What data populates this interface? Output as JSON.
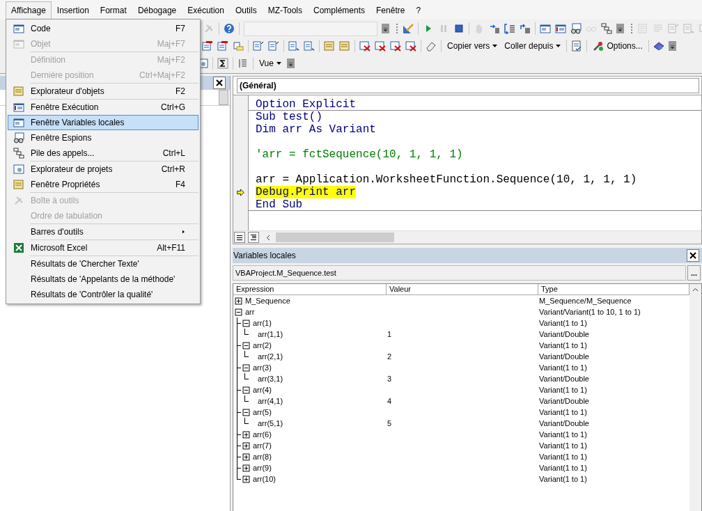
{
  "menubar": [
    {
      "label": "Affichage",
      "selected": true
    },
    {
      "label": "Insertion",
      "selected": false
    },
    {
      "label": "Format",
      "selected": false
    },
    {
      "label": "Débogage",
      "selected": false
    },
    {
      "label": "Exécution",
      "selected": false
    },
    {
      "label": "Outils",
      "selected": false
    },
    {
      "label": "MZ-Tools",
      "selected": false
    },
    {
      "label": "Compléments",
      "selected": false
    },
    {
      "label": "Fenêtre",
      "selected": false
    },
    {
      "label": "?",
      "selected": false
    }
  ],
  "toolbar_rows": [
    [
      {
        "kind": "icon",
        "disabled": true
      },
      {
        "kind": "separator"
      },
      {
        "kind": "icon",
        "disabled": false
      },
      {
        "kind": "separator"
      },
      {
        "kind": "combo",
        "disabled": true
      },
      {
        "kind": "overflow"
      },
      {
        "kind": "grip"
      },
      {
        "kind": "icon",
        "disabled": false
      },
      {
        "kind": "separator"
      },
      {
        "kind": "icon",
        "disabled": false
      },
      {
        "kind": "icon",
        "disabled": true
      },
      {
        "kind": "icon",
        "disabled": false
      },
      {
        "kind": "separator"
      },
      {
        "kind": "icon",
        "disabled": true
      },
      {
        "kind": "icon",
        "disabled": false
      },
      {
        "kind": "icon",
        "disabled": false
      },
      {
        "kind": "icon",
        "disabled": false
      },
      {
        "kind": "separator"
      },
      {
        "kind": "icon",
        "disabled": false
      },
      {
        "kind": "icon",
        "disabled": false
      },
      {
        "kind": "icon",
        "disabled": false
      },
      {
        "kind": "icon",
        "disabled": true
      },
      {
        "kind": "icon",
        "disabled": false
      },
      {
        "kind": "overflow"
      },
      {
        "kind": "grip"
      },
      {
        "kind": "icon",
        "disabled": true
      },
      {
        "kind": "icon",
        "disabled": true
      },
      {
        "kind": "icon",
        "disabled": true
      },
      {
        "kind": "icon",
        "disabled": true
      },
      {
        "kind": "icon",
        "disabled": true
      }
    ],
    [
      {
        "kind": "icon",
        "disabled": false
      },
      {
        "kind": "icon",
        "disabled": false
      },
      {
        "kind": "icon",
        "disabled": false
      },
      {
        "kind": "separator"
      },
      {
        "kind": "icon",
        "disabled": false
      },
      {
        "kind": "icon",
        "disabled": false
      },
      {
        "kind": "separator"
      },
      {
        "kind": "icon",
        "disabled": false
      },
      {
        "kind": "icon",
        "disabled": false
      },
      {
        "kind": "separator"
      },
      {
        "kind": "icon",
        "disabled": false
      },
      {
        "kind": "icon",
        "disabled": false
      },
      {
        "kind": "separator"
      },
      {
        "kind": "icon",
        "disabled": false
      },
      {
        "kind": "icon",
        "disabled": false
      },
      {
        "kind": "icon",
        "disabled": false
      },
      {
        "kind": "icon",
        "disabled": false
      },
      {
        "kind": "separator"
      },
      {
        "kind": "icon",
        "disabled": false
      },
      {
        "kind": "separator"
      },
      {
        "kind": "dropdown",
        "label": "Copier vers"
      },
      {
        "kind": "dropdown",
        "label": "Coller depuis"
      },
      {
        "kind": "separator"
      },
      {
        "kind": "icon",
        "disabled": false
      },
      {
        "kind": "separator"
      },
      {
        "kind": "iconbutton",
        "label": "Options..."
      },
      {
        "kind": "separator"
      },
      {
        "kind": "icon",
        "disabled": false
      },
      {
        "kind": "overflow"
      }
    ],
    [
      {
        "kind": "icon",
        "disabled": false
      },
      {
        "kind": "separator"
      },
      {
        "kind": "icon",
        "disabled": false
      },
      {
        "kind": "separator"
      },
      {
        "kind": "icon",
        "disabled": false
      },
      {
        "kind": "separator"
      },
      {
        "kind": "dropdown",
        "label": "Vue"
      },
      {
        "kind": "overflow"
      }
    ]
  ],
  "menu": [
    {
      "kind": "item",
      "label": "Code",
      "shortcut": "F7",
      "disabled": false,
      "selected": false
    },
    {
      "kind": "item",
      "label": "Objet",
      "shortcut": "Maj+F7",
      "disabled": true,
      "selected": false
    },
    {
      "kind": "separator"
    },
    {
      "kind": "item",
      "label": "Définition",
      "shortcut": "Maj+F2",
      "disabled": true,
      "selected": false
    },
    {
      "kind": "item",
      "label": "Dernière position",
      "shortcut": "Ctrl+Maj+F2",
      "disabled": true,
      "selected": false
    },
    {
      "kind": "separator"
    },
    {
      "kind": "item",
      "label": "Explorateur d'objets",
      "shortcut": "F2",
      "disabled": false,
      "selected": false
    },
    {
      "kind": "separator"
    },
    {
      "kind": "item",
      "label": "Fenêtre Exécution",
      "shortcut": "Ctrl+G",
      "disabled": false,
      "selected": false
    },
    {
      "kind": "item",
      "label": "Fenêtre Variables locales",
      "disabled": false,
      "selected": true
    },
    {
      "kind": "item",
      "label": "Fenêtre Espions",
      "disabled": false,
      "selected": false
    },
    {
      "kind": "item",
      "label": "Pile des appels...",
      "shortcut": "Ctrl+L",
      "disabled": false,
      "selected": false
    },
    {
      "kind": "separator"
    },
    {
      "kind": "item",
      "label": "Explorateur de projets",
      "shortcut": "Ctrl+R",
      "disabled": false,
      "selected": false
    },
    {
      "kind": "item",
      "label": "Fenêtre Propriétés",
      "shortcut": "F4",
      "disabled": false,
      "selected": false
    },
    {
      "kind": "separator"
    },
    {
      "kind": "item",
      "label": "Boîte à outils",
      "disabled": true,
      "selected": false
    },
    {
      "kind": "item",
      "label": "Ordre de tabulation",
      "disabled": true,
      "selected": false
    },
    {
      "kind": "separator"
    },
    {
      "kind": "submenu",
      "label": "Barres d'outils",
      "disabled": false,
      "selected": false
    },
    {
      "kind": "separator"
    },
    {
      "kind": "item",
      "label": "Microsoft Excel",
      "shortcut": "Alt+F11",
      "disabled": false,
      "selected": false
    },
    {
      "kind": "separator"
    },
    {
      "kind": "item",
      "label": "Résultats de 'Chercher Texte'",
      "disabled": false,
      "selected": false
    },
    {
      "kind": "item",
      "label": "Résultats de 'Appelants de la méthode'",
      "disabled": false,
      "selected": false
    },
    {
      "kind": "item",
      "label": "Résultats de 'Contrôler la qualité'",
      "disabled": false,
      "selected": false
    }
  ],
  "code_window": {
    "procedure": "(Général)",
    "lines": [
      {
        "kind": "keyword",
        "text": "Option Explicit",
        "current": false,
        "separator_after": true
      },
      {
        "kind": "keyword",
        "text": "Sub test()",
        "current": false,
        "separator_after": false
      },
      {
        "kind": "keyword",
        "text": "Dim arr As Variant",
        "current": false,
        "separator_after": false
      },
      {
        "kind": "blank",
        "current": false,
        "separator_after": false
      },
      {
        "kind": "comment",
        "text": "'arr = fctSequence(10, 1, 1, 1)",
        "current": false,
        "separator_after": false
      },
      {
        "kind": "blank",
        "current": false,
        "separator_after": false
      },
      {
        "kind": "plain",
        "text": "arr = Application.WorksheetFunction.Sequence(10, 1, 1, 1)",
        "current": false,
        "separator_after": false
      },
      {
        "kind": "keyword",
        "text": "Debug.Print arr",
        "current": true,
        "separator_after": false
      },
      {
        "kind": "keyword",
        "text": "End Sub",
        "current": false,
        "separator_after": true
      }
    ]
  },
  "locals": {
    "title": "Variables locales",
    "context": "VBAProject.M_Sequence.test",
    "context_button": "...",
    "columns": [
      "Expression",
      "Valeur",
      "Type"
    ],
    "rows": [
      {
        "expression": "M_Sequence",
        "type": "M_Sequence/M_Sequence",
        "expanded": false
      },
      {
        "expression": "arr",
        "type": "Variant/Variant(1 to 10, 1 to 1)",
        "expanded": true,
        "children": [
          {
            "expression": "arr(1)",
            "type": "Variant(1 to 1)",
            "expanded": true,
            "children": [
              {
                "expression": "arr(1,1)",
                "value": "1",
                "type": "Variant/Double"
              }
            ]
          },
          {
            "expression": "arr(2)",
            "type": "Variant(1 to 1)",
            "expanded": true,
            "children": [
              {
                "expression": "arr(2,1)",
                "value": "2",
                "type": "Variant/Double"
              }
            ]
          },
          {
            "expression": "arr(3)",
            "type": "Variant(1 to 1)",
            "expanded": true,
            "children": [
              {
                "expression": "arr(3,1)",
                "value": "3",
                "type": "Variant/Double"
              }
            ]
          },
          {
            "expression": "arr(4)",
            "type": "Variant(1 to 1)",
            "expanded": true,
            "children": [
              {
                "expression": "arr(4,1)",
                "value": "4",
                "type": "Variant/Double"
              }
            ]
          },
          {
            "expression": "arr(5)",
            "type": "Variant(1 to 1)",
            "expanded": true,
            "children": [
              {
                "expression": "arr(5,1)",
                "value": "5",
                "type": "Variant/Double"
              }
            ]
          },
          {
            "expression": "arr(6)",
            "type": "Variant(1 to 1)",
            "expanded": false
          },
          {
            "expression": "arr(7)",
            "type": "Variant(1 to 1)",
            "expanded": false
          },
          {
            "expression": "arr(8)",
            "type": "Variant(1 to 1)",
            "expanded": false
          },
          {
            "expression": "arr(9)",
            "type": "Variant(1 to 1)",
            "expanded": false
          },
          {
            "expression": "arr(10)",
            "type": "Variant(1 to 1)",
            "expanded": false
          }
        ]
      }
    ]
  }
}
